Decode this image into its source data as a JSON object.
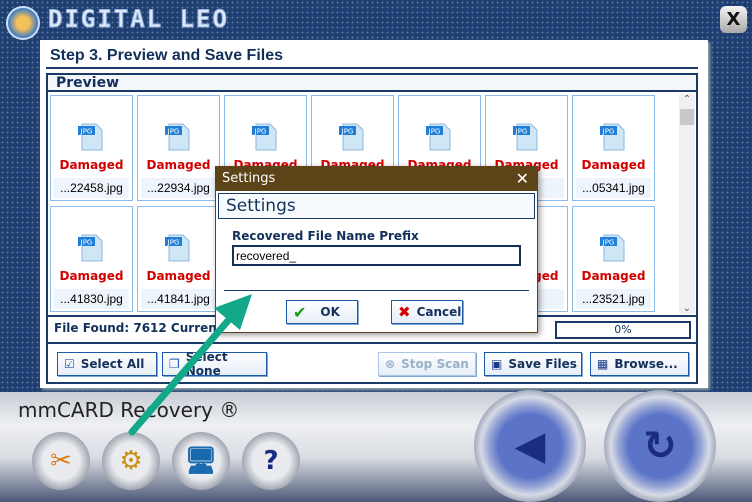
{
  "app": {
    "brand": "DIGITAL LEO",
    "product": "mmCARD Recovery ®",
    "close_label": "X"
  },
  "step_title": "Step 3. Preview and Save Files",
  "preview": {
    "header": "Preview",
    "status_label": "Damaged",
    "row1": [
      {
        "name": "...22458.jpg"
      },
      {
        "name": "...22934.jpg"
      },
      {
        "name": ""
      },
      {
        "name": ""
      },
      {
        "name": ""
      },
      {
        "name": ".jpg"
      },
      {
        "name": "...05341.jpg"
      }
    ],
    "row2": [
      {
        "name": "...41830.jpg"
      },
      {
        "name": "...41841.jpg"
      },
      {
        "name": ""
      },
      {
        "name": ""
      },
      {
        "name": ""
      },
      {
        "name": ".jpg"
      },
      {
        "name": "...23521.jpg"
      }
    ],
    "icon_label": "JPG"
  },
  "status": {
    "files_found": "File Found: 7612   Current S",
    "progress_text": "0%",
    "progress": 0
  },
  "buttons": {
    "select_all": "Select All",
    "select_none": "Select None",
    "stop_scan": "Stop Scan",
    "save_files": "Save Files",
    "browse": "Browse..."
  },
  "dialog": {
    "title": "Settings",
    "header": "Settings",
    "field_label": "Recovered File Name Prefix",
    "field_value": "recovered_",
    "ok": "OK",
    "cancel": "Cancel"
  },
  "colors": {
    "accent": "#12305a",
    "damaged": "#d40000",
    "dialog_titlebar": "#5c4318",
    "arrow": "#13a88a"
  }
}
